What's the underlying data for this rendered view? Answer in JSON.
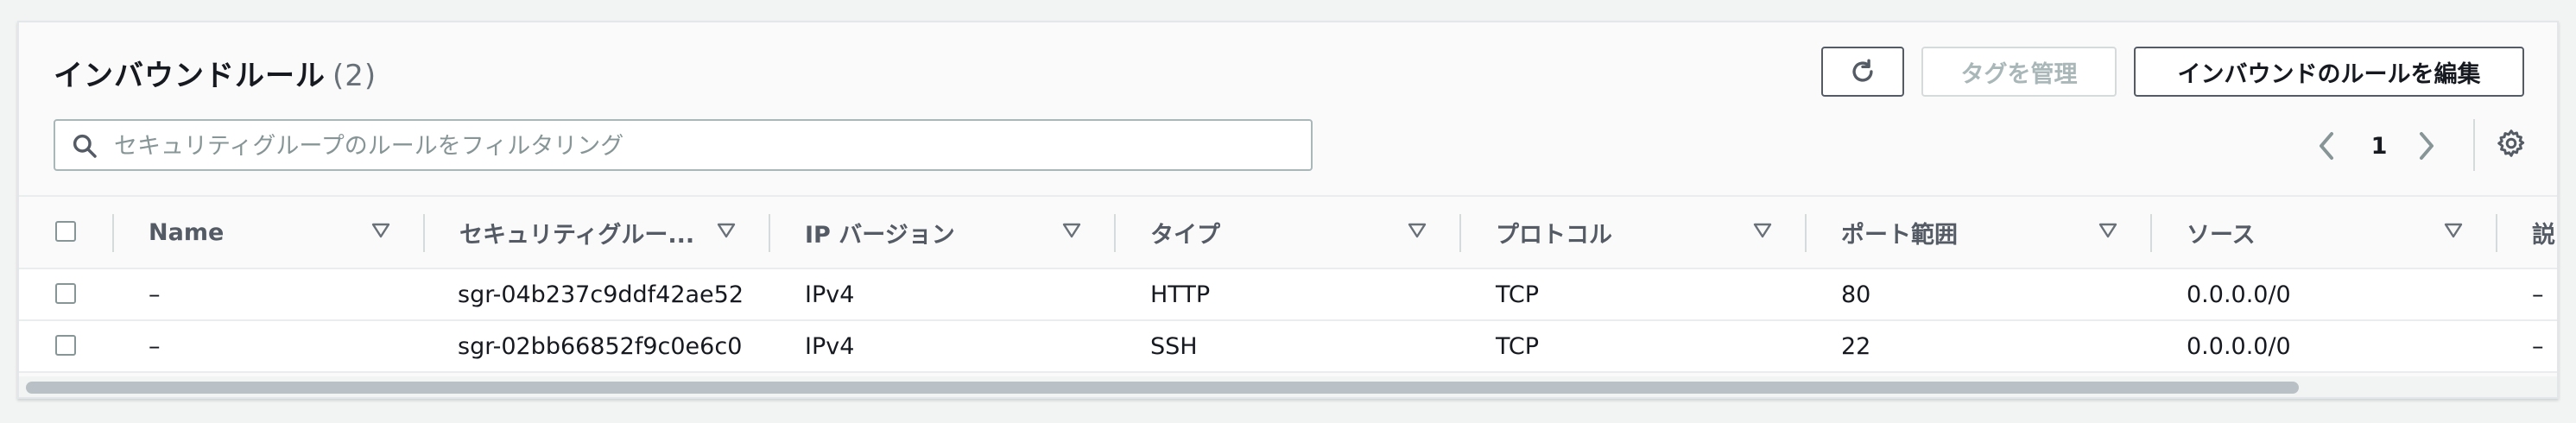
{
  "header": {
    "title": "インバウンドルール",
    "count": "(2)"
  },
  "toolbar": {
    "refresh_icon": "refresh-icon",
    "manage_tags_label": "タグを管理",
    "edit_rules_label": "インバウンドのルールを編集"
  },
  "search": {
    "placeholder": "セキュリティグループのルールをフィルタリング",
    "value": ""
  },
  "pagination": {
    "current_page": "1"
  },
  "table": {
    "columns": [
      "Name",
      "セキュリティグルー...",
      "IP バージョン",
      "タイプ",
      "プロトコル",
      "ポート範囲",
      "ソース",
      "説"
    ],
    "rows": [
      {
        "name": "–",
        "security_group_rule": "sgr-04b237c9ddf42ae52",
        "ip_version": "IPv4",
        "type": "HTTP",
        "protocol": "TCP",
        "port_range": "80",
        "source": "0.0.0.0/0",
        "description": "–"
      },
      {
        "name": "–",
        "security_group_rule": "sgr-02bb66852f9c0e6c0",
        "ip_version": "IPv4",
        "type": "SSH",
        "protocol": "TCP",
        "port_range": "22",
        "source": "0.0.0.0/0",
        "description": "–"
      }
    ]
  },
  "colors": {
    "border_dark": "#545b64",
    "disabled": "#aab7b8",
    "text": "#16191f"
  }
}
